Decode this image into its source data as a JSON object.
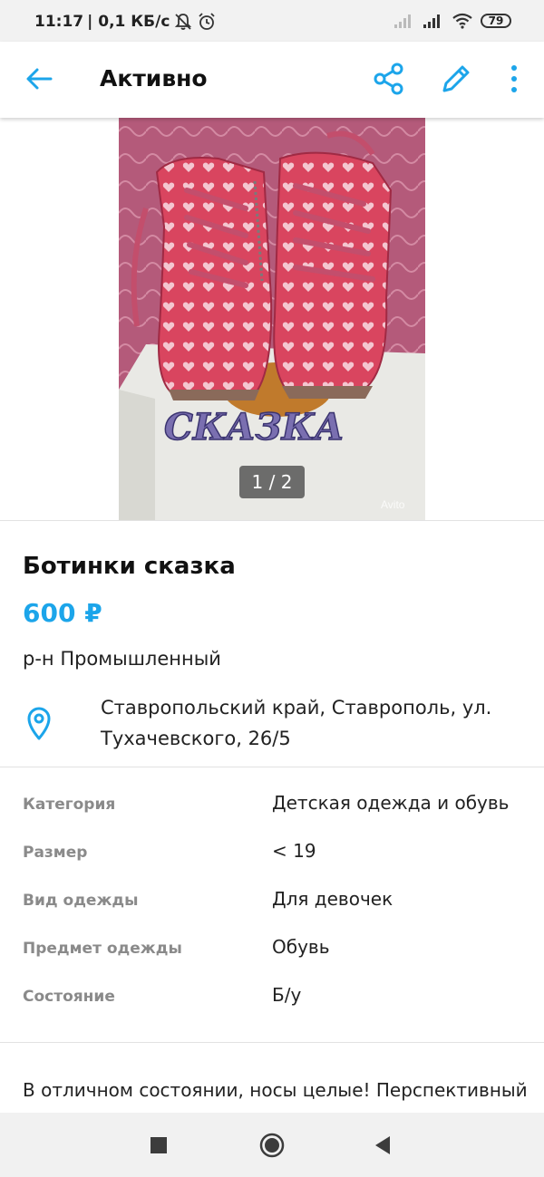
{
  "status_bar": {
    "time": "11:17",
    "speed": "| 0,1 КБ/с",
    "battery": "79"
  },
  "app_bar": {
    "title": "Активно"
  },
  "gallery": {
    "counter": "1 / 2",
    "watermark": "Avito"
  },
  "listing": {
    "title": "Ботинки сказка",
    "price": "600 ₽",
    "district": "р-н Промышленный",
    "address_line1": "Ставропольский край, Ставрополь, ул.",
    "address_line2": "Тухачевского, 26/5"
  },
  "params": [
    {
      "key": "Категория",
      "value": "Детская одежда и обувь"
    },
    {
      "key": "Размер",
      "value": "< 19"
    },
    {
      "key": "Вид одежды",
      "value": "Для девочек"
    },
    {
      "key": "Предмет одежды",
      "value": "Обувь"
    },
    {
      "key": "Состояние",
      "value": "Б/у"
    }
  ],
  "description": "В отличном состоянии, носы целые!   Перспективный",
  "colors": {
    "accent": "#1ca5ea",
    "shoe": "#d9455f"
  }
}
